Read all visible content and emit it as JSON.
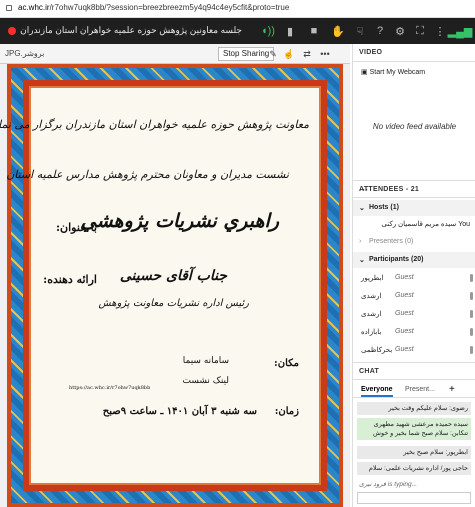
{
  "browser": {
    "url_host": "ac.whc.ir",
    "url_rest": "/r7ohw7uqk8bb/?session=breezbreezm5y4q94c4ey5cfit&proto=true"
  },
  "topbar": {
    "title": "جلسه معاونین پژوهش حوزه علمیه خواهران استان مازندران"
  },
  "share": {
    "file_name": "JPG.بروشر",
    "stop_label": "Stop Sharing"
  },
  "poster": {
    "line1": "معاونت پژوهش حوزه علمیه خواهران استان مازندران برگزار می نماید؛",
    "line2": "نشست مدیران و معاونان محترم پژوهش مدارس علمیه استان",
    "title_label": "با عنوان:",
    "title": "راهبري نشريات پژوهشي",
    "presenter_label": "ارائه دهنده:",
    "presenter": "جناب آقای حسینی",
    "presenter_role": "رئیس اداره نشریات معاونت پژوهش",
    "place_label": "مکان:",
    "place_value": "سامانه سیما",
    "link_label": "لینک نشست",
    "link_url": "https://ac.whc.ir/r7ohw7uqk8bb",
    "time_label": "زمان:",
    "time_value": "سه شنبه ۳ آبان ۱۴۰۱ ـ ساعت ۹صبح"
  },
  "video": {
    "header": "VIDEO",
    "webcam_label": "Start My Webcam",
    "no_feed": "No video feed available"
  },
  "attendees": {
    "header": "ATTENDEES - 21",
    "hosts_label": "Hosts (1)",
    "host_name": "You سیده مریم قاسمیان رکنی",
    "presenters_label": "Presenters (0)",
    "participants_label": "Participants (20)",
    "participants": [
      {
        "name": "ابطرپور",
        "role": "Guest"
      },
      {
        "name": "ارشدی",
        "role": "Guest"
      },
      {
        "name": "ارشدی",
        "role": "Guest"
      },
      {
        "name": "بابازاده",
        "role": "Guest"
      },
      {
        "name": "بحرکاظمی",
        "role": "Guest"
      }
    ]
  },
  "chat": {
    "header": "CHAT",
    "tab_everyone": "Everyone",
    "tab_presenters": "Present...",
    "messages": [
      {
        "text": "رضوی: سلام علیکم وقت بخیر",
        "green": false
      },
      {
        "text": "سیده حمیده مرعشی شهید مطهری تنکابن: سلام صبح شما بخیر و خوش",
        "green": true
      },
      {
        "text": "ابطرپور: سلام صبح بخیر",
        "green": false
      },
      {
        "text": "حاجی پور/ اداره نشریات علمی: سلام",
        "green": false
      }
    ],
    "typing": "فرود نیری is typing..."
  }
}
